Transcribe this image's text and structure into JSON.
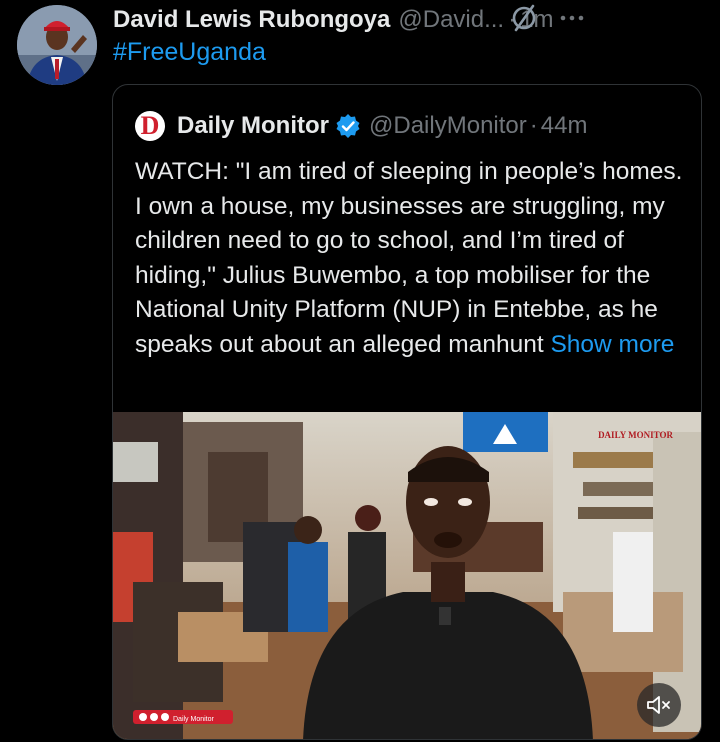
{
  "post": {
    "author_name": "David Lewis Rubongoya",
    "handle": "@David...",
    "separator": "·",
    "time": "1m",
    "hashtag": "#FreeUganda"
  },
  "quote": {
    "name": "Daily Monitor",
    "handle": "@DailyMonitor",
    "separator": "·",
    "time": "44m",
    "logo_letter": "D",
    "text": "WATCH: \"I am tired of sleeping in people’s homes. I own a house, my businesses are struggling, my children need to go to school, and I’m tired of hiding,\" Julius Buwembo, a top mobiliser for the National Unity Platform (NUP) in Entebbe, as he speaks out about an alleged manhunt",
    "show_more": "Show more"
  },
  "video": {
    "watermark": "DAILY MONITOR",
    "lower_tag": "Daily Monitor"
  },
  "icons": {
    "grok": "grok-icon",
    "more": "more-icon",
    "verified": "verified-icon",
    "mute": "mute-icon"
  },
  "colors": {
    "accent": "#1d9bf0",
    "secondary_text": "#71767b",
    "logo_red": "#d0202e"
  }
}
